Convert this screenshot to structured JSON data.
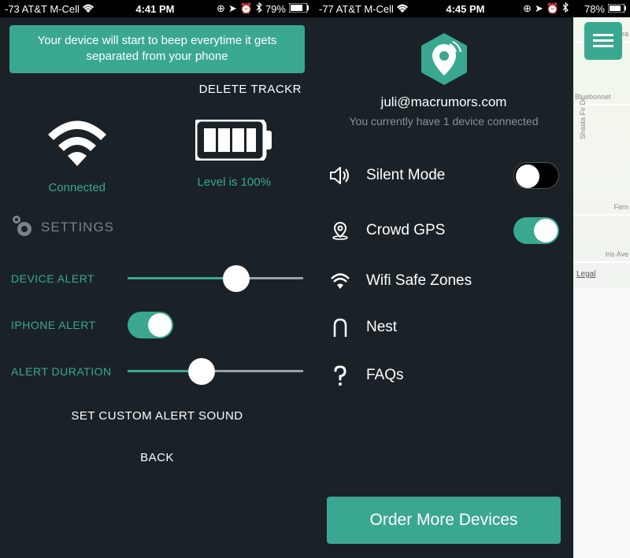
{
  "left": {
    "status_bar": {
      "signal": "-73 AT&T M-Cell",
      "time": "4:41 PM",
      "battery": "79%"
    },
    "banner": "Your device will start to beep everytime it gets separated from your phone",
    "delete_trackr": "DELETE TRACKR",
    "wifi_status": "Connected",
    "battery_status": "Level is 100%",
    "settings_title": "SETTINGS",
    "device_alert": {
      "label": "DEVICE ALERT",
      "value_percent": 62
    },
    "iphone_alert": {
      "label": "IPHONE ALERT",
      "value": true
    },
    "alert_duration": {
      "label": "ALERT DURATION",
      "value_percent": 42
    },
    "set_custom_sound": "SET CUSTOM ALERT SOUND",
    "back": "BACK"
  },
  "right": {
    "status_bar": {
      "signal": "-77 AT&T M-Cell",
      "time": "4:45 PM",
      "battery": "78%"
    },
    "email": "juli@macrumors.com",
    "device_count_text": "You currently have 1 device connected",
    "menu": {
      "silent_mode": {
        "label": "Silent Mode",
        "value": false
      },
      "crowd_gps": {
        "label": "Crowd GPS",
        "value": true
      },
      "wifi_safe_zones": {
        "label": "Wifi Safe Zones"
      },
      "nest": {
        "label": "Nest"
      },
      "faqs": {
        "label": "FAQs"
      }
    },
    "order_button": "Order More Devices",
    "map": {
      "streets": [
        "Azalea",
        "Bluebonnet",
        "Shasta Fir Dr",
        "Fern",
        "Iris Ave"
      ],
      "legal": "Legal"
    }
  }
}
